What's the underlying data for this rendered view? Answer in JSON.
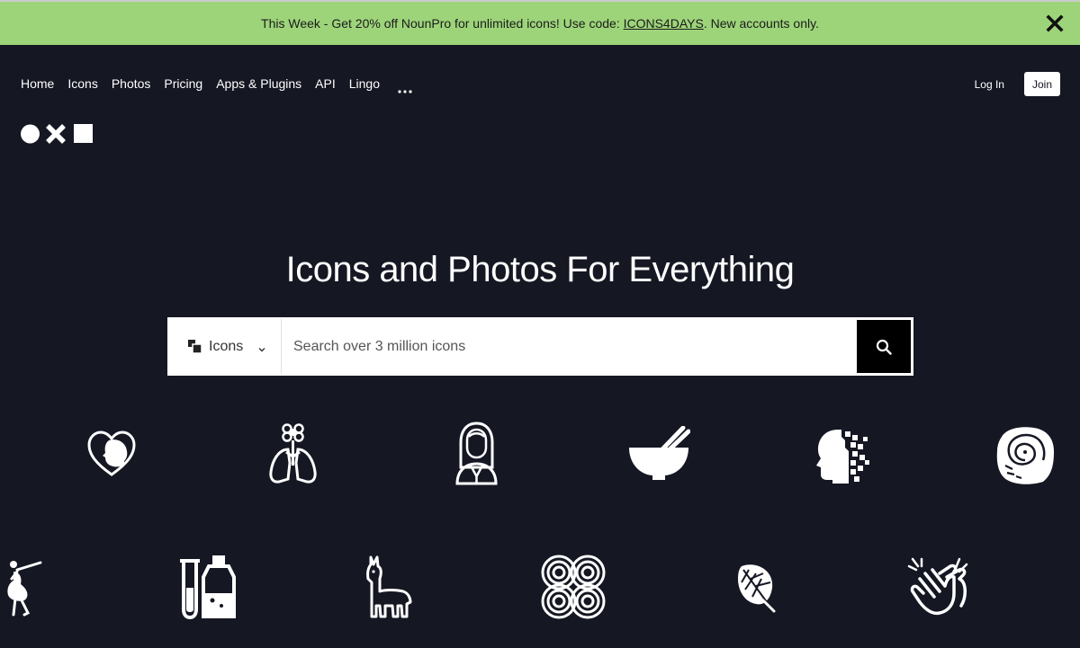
{
  "promo": {
    "text_before": "This Week - Get 20% off NounPro for unlimited icons! Use code: ",
    "code": "ICONS4DAYS",
    "text_after": ". New accounts only."
  },
  "nav": {
    "items": [
      "Home",
      "Icons",
      "Photos",
      "Pricing",
      "Apps & Plugins",
      "API",
      "Lingo"
    ],
    "more_icon": "more-dots-icon"
  },
  "auth": {
    "login": "Log In",
    "join": "Join"
  },
  "hero": {
    "title": "Icons and Photos For Everything"
  },
  "search": {
    "type_label": "Icons",
    "placeholder": "Search over 3 million icons"
  },
  "icons": [
    "heart-face-icon",
    "lungs-flower-icon",
    "woman-portrait-icon",
    "bowl-chopsticks-icon",
    "digital-head-icon",
    "fossil-ammonite-icon",
    "dancer-icon",
    "test-tube-bottle-icon",
    "llama-icon",
    "interlocking-circles-icon",
    "monstera-leaf-icon",
    "clapping-hands-icon"
  ],
  "colors": {
    "background": "#151723",
    "promo_background": "#9dd47a",
    "text": "#ffffff"
  }
}
